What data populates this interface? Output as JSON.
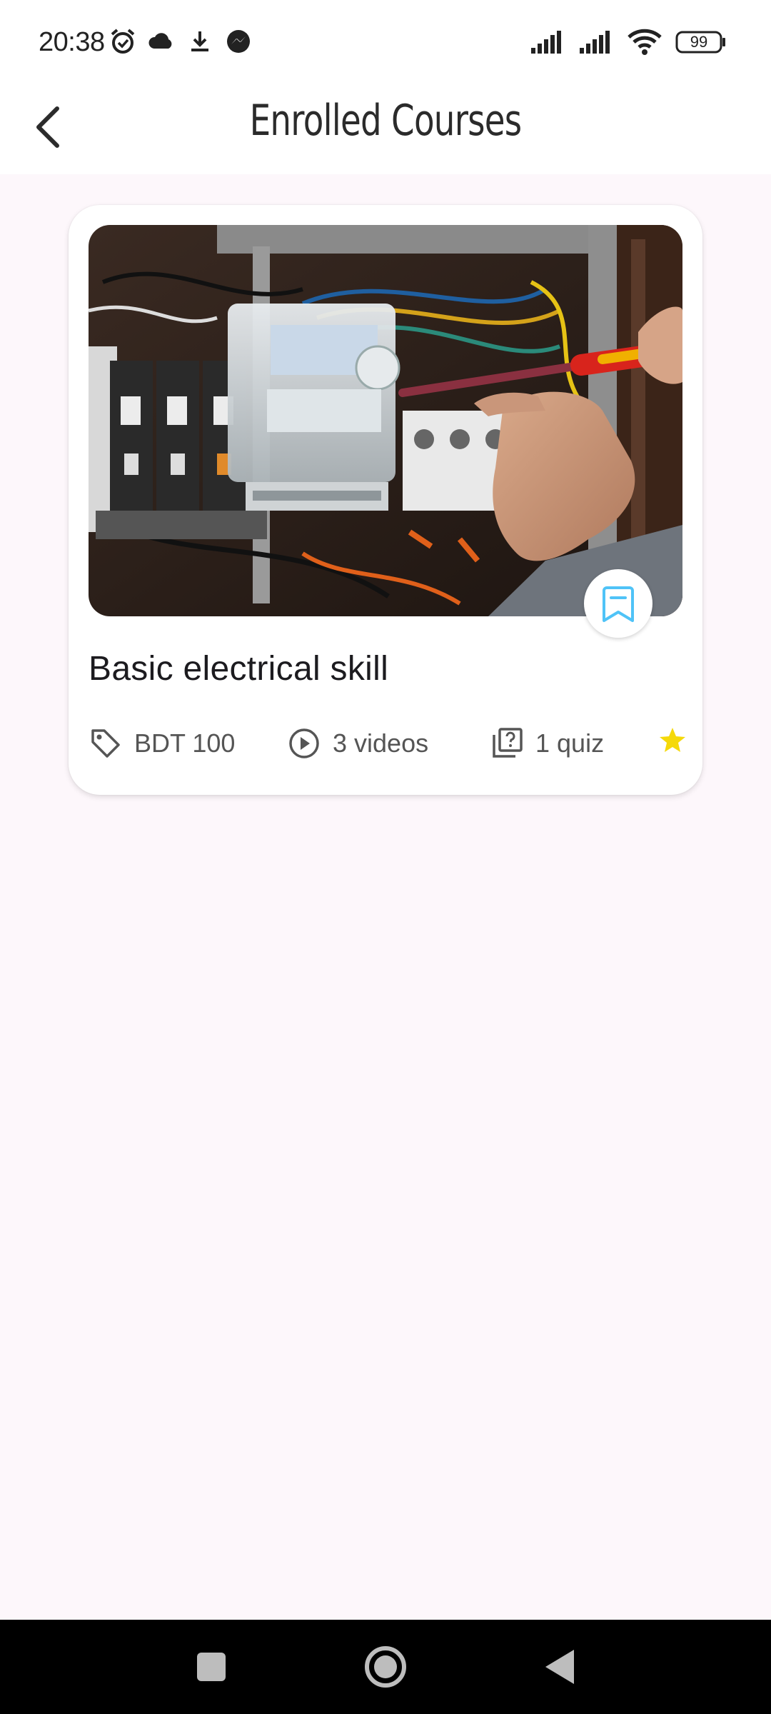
{
  "status_bar": {
    "time": "20:38",
    "battery": "99",
    "left_icons": [
      "alarm-icon",
      "cloud-icon",
      "download-icon",
      "messenger-icon"
    ],
    "right_icons": [
      "signal-icon",
      "signal-icon",
      "wifi-icon",
      "battery-icon"
    ]
  },
  "header": {
    "title": "Enrolled Courses",
    "back_icon": "back-arrow-icon"
  },
  "courses": [
    {
      "title": "Basic electrical skill",
      "image": "electrical-panel-photo",
      "price": "BDT 100",
      "videos": "3 videos",
      "quiz": "1 quiz",
      "bookmark_icon": "bookmark-icon",
      "accent": "#4fc3f7",
      "star_color": "#f5d90a"
    }
  ],
  "nav_bar": {
    "buttons": [
      "recents-button",
      "home-button",
      "back-button"
    ]
  }
}
